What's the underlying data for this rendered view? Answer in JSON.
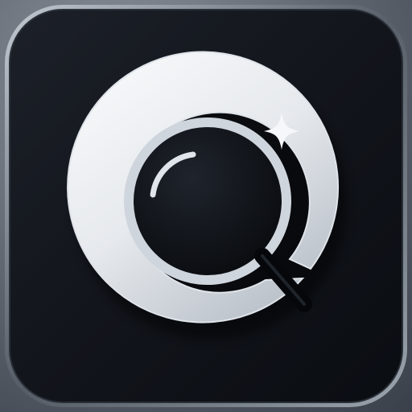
{
  "app_icon": {
    "icon": "magnifier-sparkle-icon",
    "colors": {
      "tile_outer": "#11141a",
      "tile_inner": "#0a0d12",
      "tile_rim": "#9aa3ad",
      "ring_light": "#f4f6f8",
      "ring_shadow": "#b9c0c8",
      "glass": "#0f1217",
      "sparkle": "#f5f7fa",
      "handle": "#05070a"
    }
  }
}
